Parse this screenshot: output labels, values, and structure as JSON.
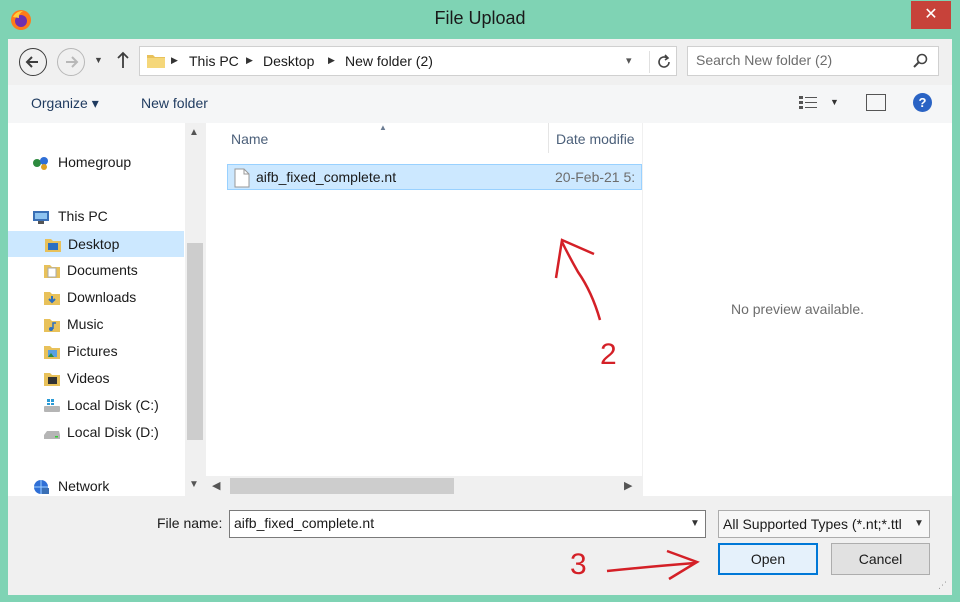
{
  "window": {
    "title": "File Upload",
    "close_glyph": "✕",
    "app_icon": "firefox-icon"
  },
  "address": {
    "crumbs": [
      "This PC",
      "Desktop",
      "New folder (2)"
    ],
    "search_placeholder": "Search New folder (2)"
  },
  "toolbar": {
    "organize": "Organize ▾",
    "new_folder": "New folder",
    "help_glyph": "?"
  },
  "nav": {
    "items": [
      {
        "label": "Homegroup",
        "icon": "homegroup-icon"
      },
      {
        "label": "This PC",
        "icon": "computer-icon"
      },
      {
        "label": "Desktop",
        "icon": "desktop-folder-icon"
      },
      {
        "label": "Documents",
        "icon": "documents-folder-icon"
      },
      {
        "label": "Downloads",
        "icon": "downloads-folder-icon"
      },
      {
        "label": "Music",
        "icon": "music-folder-icon"
      },
      {
        "label": "Pictures",
        "icon": "pictures-folder-icon"
      },
      {
        "label": "Videos",
        "icon": "videos-folder-icon"
      },
      {
        "label": "Local Disk (C:)",
        "icon": "drive-c-icon"
      },
      {
        "label": "Local Disk (D:)",
        "icon": "drive-d-icon"
      },
      {
        "label": "Network",
        "icon": "network-icon"
      }
    ],
    "selected": "Desktop"
  },
  "files": {
    "columns": [
      "Name",
      "Date modifie"
    ],
    "rows": [
      {
        "name": "aifb_fixed_complete.nt",
        "date": "20-Feb-21 5:"
      }
    ]
  },
  "preview": {
    "message": "No preview available."
  },
  "bottom": {
    "file_name_label": "File name:",
    "file_name_value": "aifb_fixed_complete.nt",
    "file_type": "All Supported Types (*.nt;*.ttl",
    "open_label": "Open",
    "cancel_label": "Cancel"
  },
  "annotations": {
    "step2": "2",
    "step3": "3",
    "color": "#d42027"
  }
}
